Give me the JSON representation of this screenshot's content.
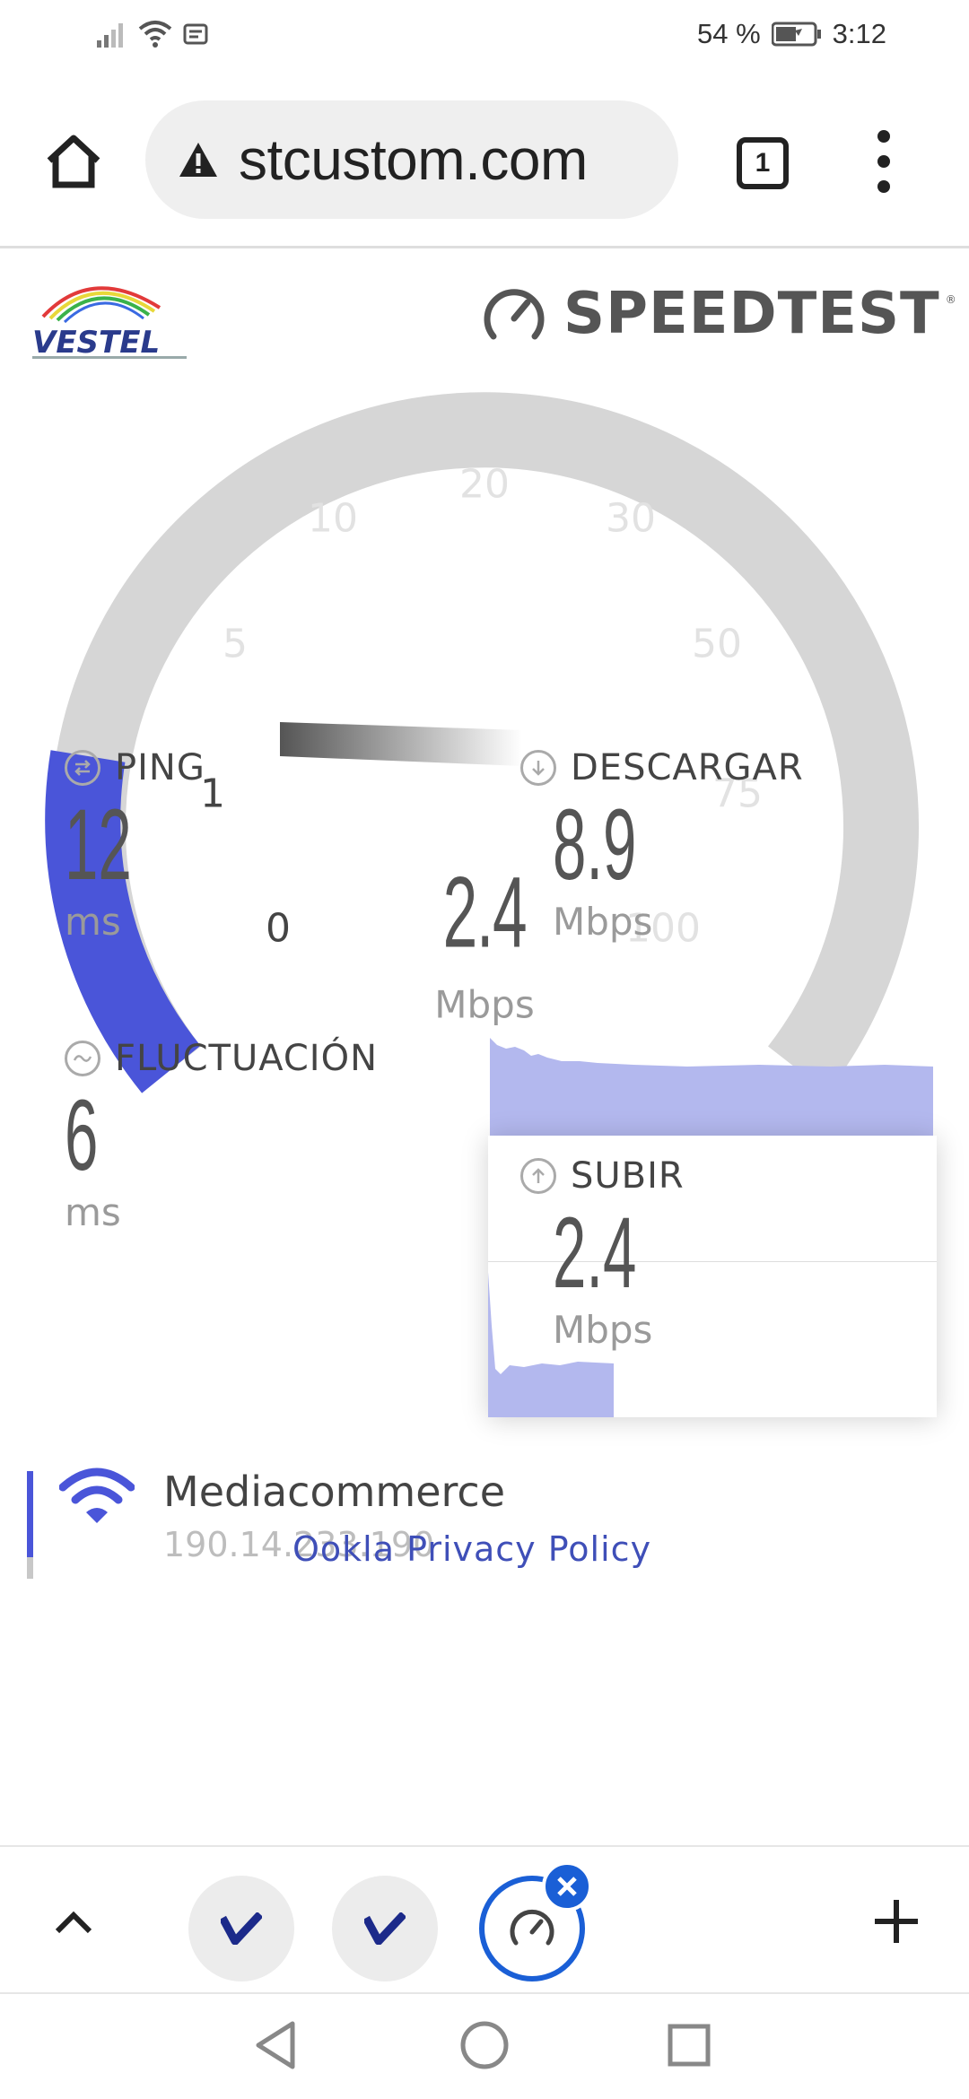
{
  "status_bar": {
    "battery": "54 %",
    "time": "3:12"
  },
  "browser": {
    "url": "stcustom.com",
    "tab_count": "1"
  },
  "brand": {
    "partner_logo_text": "VESTEL",
    "speedtest_label": "SPEEDTEST",
    "accent_color": "#4a55d9"
  },
  "gauge": {
    "scale_labels": [
      "0",
      "1",
      "5",
      "10",
      "20",
      "30",
      "50",
      "75",
      "100"
    ],
    "active_label": "1",
    "value": "2.4",
    "unit": "Mbps",
    "fill_fraction": 0.1
  },
  "metrics": {
    "ping": {
      "title": "PING",
      "value": "12",
      "unit": "ms"
    },
    "download": {
      "title": "DESCARGAR",
      "value": "8.9",
      "unit": "Mbps"
    },
    "jitter": {
      "title": "FLUCTUACIÓN",
      "value": "6",
      "unit": "ms"
    },
    "upload": {
      "title": "SUBIR",
      "value": "2.4",
      "unit": "Mbps"
    }
  },
  "server": {
    "name": "Mediacommerce",
    "ip": "190.14.233.190"
  },
  "privacy_link": "Ookla Privacy Policy",
  "tab_strip": {
    "tabs": [
      "vestel-tab",
      "vestel-tab",
      "speedtest-tab"
    ],
    "current": 2
  }
}
